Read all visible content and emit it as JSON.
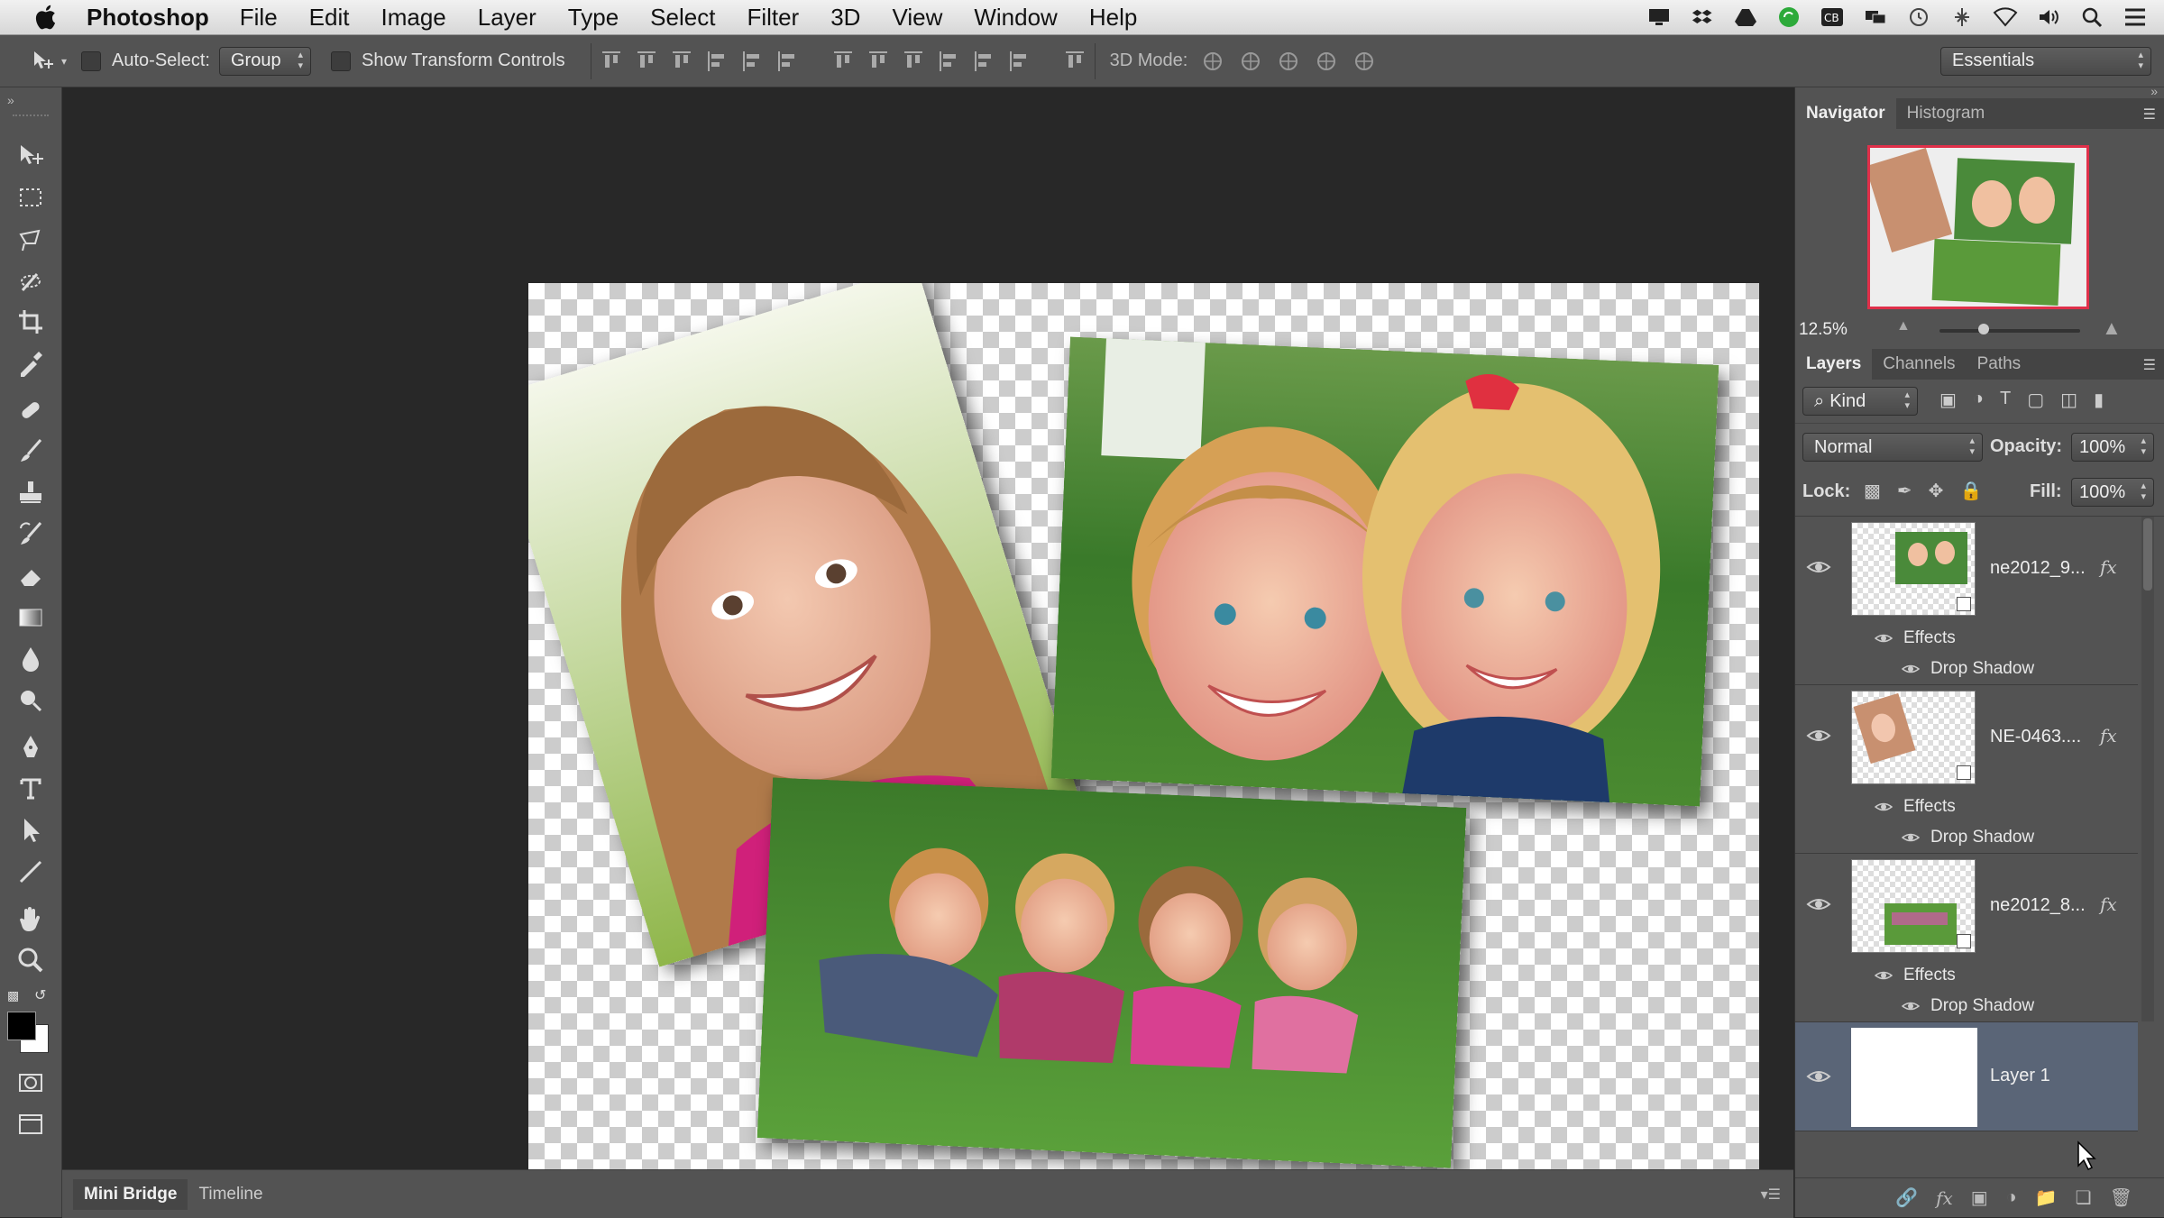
{
  "menubar": {
    "app_name": "Photoshop",
    "items": [
      "File",
      "Edit",
      "Image",
      "Layer",
      "Type",
      "Select",
      "Filter",
      "3D",
      "View",
      "Window",
      "Help"
    ]
  },
  "options": {
    "auto_select_label": "Auto-Select:",
    "auto_select_value": "Group",
    "show_transform_label": "Show Transform Controls",
    "mode_3d_label": "3D Mode:",
    "workspace_value": "Essentials"
  },
  "navigator": {
    "tabs": [
      "Navigator",
      "Histogram"
    ],
    "zoom": "12.5%"
  },
  "layers_panel": {
    "tabs": [
      "Layers",
      "Channels",
      "Paths"
    ],
    "filter_kind": "Kind",
    "blend_mode": "Normal",
    "opacity_label": "Opacity:",
    "opacity_value": "100%",
    "lock_label": "Lock:",
    "fill_label": "Fill:",
    "fill_value": "100%",
    "layers": [
      {
        "name": "ne2012_9...",
        "fx": "fx",
        "effects_label": "Effects",
        "effect": "Drop Shadow"
      },
      {
        "name": "NE-0463....",
        "fx": "fx",
        "effects_label": "Effects",
        "effect": "Drop Shadow"
      },
      {
        "name": "ne2012_8...",
        "fx": "fx",
        "effects_label": "Effects",
        "effect": "Drop Shadow"
      },
      {
        "name": "Layer 1"
      }
    ]
  },
  "bottom_tabs": [
    "Mini Bridge",
    "Timeline"
  ],
  "colors": {
    "selected_layer": "#5a6577",
    "panel_bg": "#535353",
    "canvas_bg": "#282828"
  }
}
